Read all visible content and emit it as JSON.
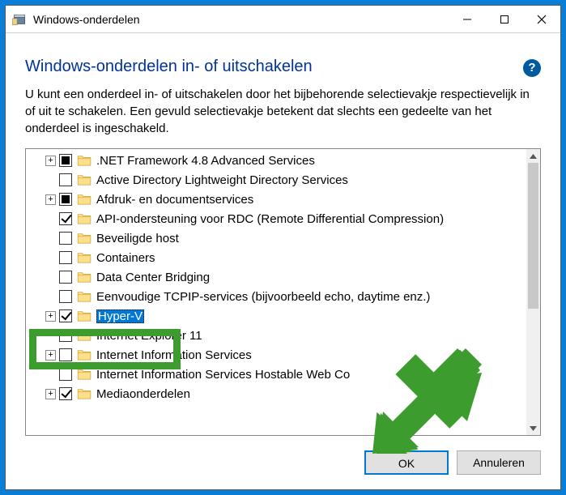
{
  "window": {
    "title": "Windows-onderdelen"
  },
  "heading": "Windows-onderdelen in- of uitschakelen",
  "description": "U kunt een onderdeel in- of uitschakelen door het bijbehorende selectievakje respectievelijk in of uit te schakelen. Een gevuld selectievakje betekent dat slechts een gedeelte van het onderdeel is ingeschakeld.",
  "items": [
    {
      "expander": "+",
      "check": "partial",
      "label": ".NET Framework 4.8 Advanced Services"
    },
    {
      "expander": "",
      "check": "unchecked",
      "label": "Active Directory Lightweight Directory Services"
    },
    {
      "expander": "+",
      "check": "partial",
      "label": "Afdruk- en documentservices"
    },
    {
      "expander": "",
      "check": "checked",
      "label": "API-ondersteuning voor RDC (Remote Differential Compression)"
    },
    {
      "expander": "",
      "check": "unchecked",
      "label": "Beveiligde host"
    },
    {
      "expander": "",
      "check": "unchecked",
      "label": "Containers"
    },
    {
      "expander": "",
      "check": "unchecked",
      "label": "Data Center Bridging"
    },
    {
      "expander": "",
      "check": "unchecked",
      "label": "Eenvoudige TCPIP-services (bijvoorbeeld echo, daytime enz.)"
    },
    {
      "expander": "+",
      "check": "checked",
      "label": "Hyper-V",
      "selected": true
    },
    {
      "expander": "",
      "check": "unchecked",
      "label": "Internet Explorer 11"
    },
    {
      "expander": "+",
      "check": "unchecked",
      "label": "Internet Information Services"
    },
    {
      "expander": "",
      "check": "unchecked",
      "label": "Internet Information Services Hostable Web Co"
    },
    {
      "expander": "+",
      "check": "checked",
      "label": "Mediaonderdelen"
    }
  ],
  "buttons": {
    "ok": "OK",
    "cancel": "Annuleren"
  }
}
